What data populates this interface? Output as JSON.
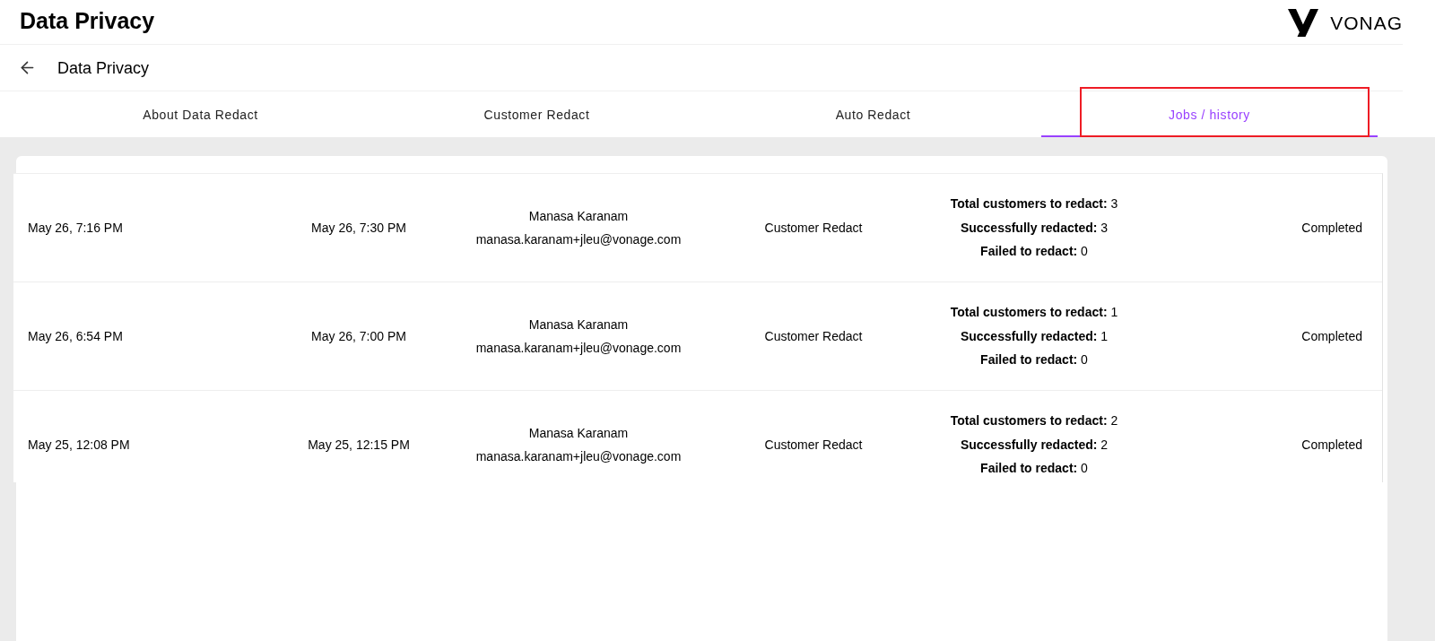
{
  "header": {
    "title": "Data Privacy",
    "logo_text": "VONAG"
  },
  "subheader": {
    "title": "Data Privacy"
  },
  "tabs": [
    {
      "label": "About Data Redact",
      "selected": false,
      "highlighted": false
    },
    {
      "label": "Customer Redact",
      "selected": false,
      "highlighted": false
    },
    {
      "label": "Auto Redact",
      "selected": false,
      "highlighted": false
    },
    {
      "label": "Jobs / history",
      "selected": true,
      "highlighted": true
    }
  ],
  "table": {
    "rows": [
      {
        "column_1": "May 26, 7:16 PM",
        "column_2": "May 26, 7:30 PM",
        "column_3": [
          "Manasa Karanam",
          "manasa.karanam+jleu@vonage.com"
        ],
        "column_4": "Customer Redact",
        "column_5": [
          "**Total customers to redact:** 3",
          "**Successfully redacted:** 3",
          "**Failed to redact:** 0"
        ],
        "column_6": "Completed"
      },
      {
        "column_1": "May 26, 6:54 PM",
        "column_2": "May 26, 7:00 PM",
        "column_3": [
          "Manasa Karanam",
          "manasa.karanam+jleu@vonage.com"
        ],
        "column_4": "Customer Redact",
        "column_5": [
          "**Total customers to redact:** 1",
          "**Successfully redacted:** 1",
          "**Failed to redact:** 0"
        ],
        "column_6": "Completed"
      },
      {
        "column_1": "May 25, 12:08 PM",
        "column_2": "May 25, 12:15 PM",
        "column_3": [
          "Manasa Karanam",
          "manasa.karanam+jleu@vonage.com"
        ],
        "column_4": "Customer Redact",
        "column_5": [
          "**Total customers to redact:** 2",
          "**Successfully redacted:** 2",
          "**Failed to redact:** 0"
        ],
        "column_6": "Completed"
      }
    ]
  }
}
